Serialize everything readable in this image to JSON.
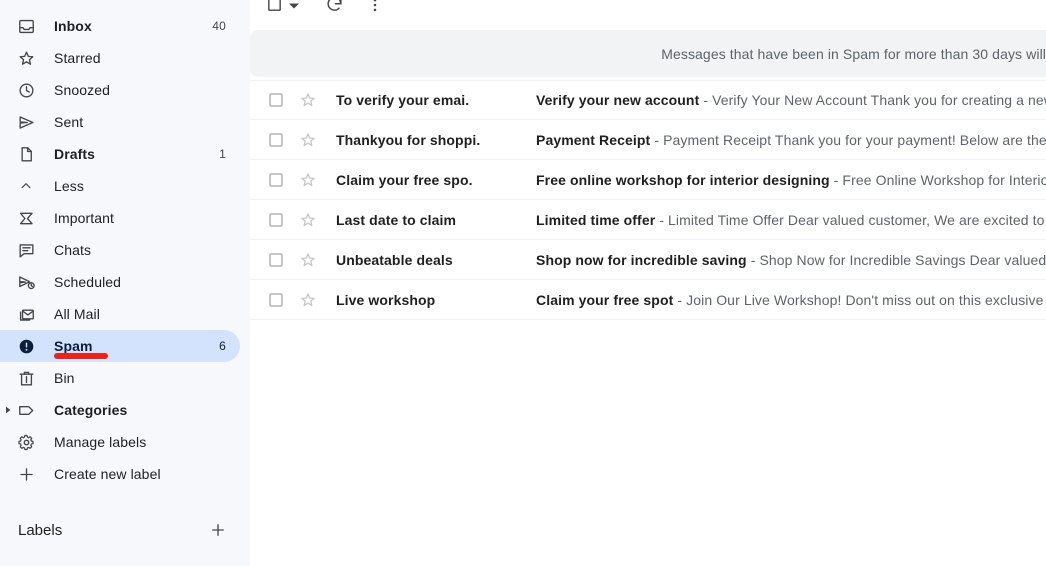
{
  "sidebar": {
    "items": [
      {
        "id": "inbox",
        "label": "Inbox",
        "count": "40",
        "icon": "inbox-icon",
        "bold": true,
        "selected": false
      },
      {
        "id": "starred",
        "label": "Starred",
        "count": "",
        "icon": "star-icon",
        "bold": false,
        "selected": false
      },
      {
        "id": "snoozed",
        "label": "Snoozed",
        "count": "",
        "icon": "clock-icon",
        "bold": false,
        "selected": false
      },
      {
        "id": "sent",
        "label": "Sent",
        "count": "",
        "icon": "send-icon",
        "bold": false,
        "selected": false
      },
      {
        "id": "drafts",
        "label": "Drafts",
        "count": "1",
        "icon": "document-icon",
        "bold": true,
        "selected": false
      },
      {
        "id": "less",
        "label": "Less",
        "count": "",
        "icon": "chevron-up-icon",
        "bold": false,
        "selected": false
      },
      {
        "id": "important",
        "label": "Important",
        "count": "",
        "icon": "important-icon",
        "bold": false,
        "selected": false
      },
      {
        "id": "chats",
        "label": "Chats",
        "count": "",
        "icon": "chat-icon",
        "bold": false,
        "selected": false
      },
      {
        "id": "scheduled",
        "label": "Scheduled",
        "count": "",
        "icon": "scheduled-send-icon",
        "bold": false,
        "selected": false
      },
      {
        "id": "all-mail",
        "label": "All Mail",
        "count": "",
        "icon": "all-mail-icon",
        "bold": false,
        "selected": false
      },
      {
        "id": "spam",
        "label": "Spam",
        "count": "6",
        "icon": "spam-alert-icon",
        "bold": true,
        "selected": true
      },
      {
        "id": "bin",
        "label": "Bin",
        "count": "",
        "icon": "trash-icon",
        "bold": false,
        "selected": false
      },
      {
        "id": "categories",
        "label": "Categories",
        "count": "",
        "icon": "label-tag-icon",
        "bold": true,
        "selected": false,
        "caret": true
      },
      {
        "id": "manage-labels",
        "label": "Manage labels",
        "count": "",
        "icon": "gear-icon",
        "bold": false,
        "selected": false
      },
      {
        "id": "create-new-label",
        "label": "Create new label",
        "count": "",
        "icon": "plus-icon",
        "bold": false,
        "selected": false
      }
    ],
    "labels_header": "Labels",
    "add_label_icon": "plus-icon",
    "selected_highlight_color": "#d3e3fd",
    "annotation_color": "#e8251d"
  },
  "toolbar": {
    "select_all_checkbox": "checkbox-icon",
    "select_dropdown": "chevron-down-icon",
    "refresh": "refresh-icon",
    "more": "more-vertical-icon"
  },
  "banner": {
    "text": "Messages that have been in Spam for more than 30 days will"
  },
  "mail_list": {
    "rows": [
      {
        "sender": "To verify your emai.",
        "subject": "Verify your new account",
        "separator": "-",
        "snippet": "Verify Your New Account Thank you for creating a new"
      },
      {
        "sender": "Thankyou for shoppi.",
        "subject": "Payment Receipt",
        "separator": "-",
        "snippet": "Payment Receipt Thank you for your payment! Below are the d"
      },
      {
        "sender": "Claim your free spo.",
        "subject": "Free online workshop for interior designing",
        "separator": "-",
        "snippet": "Free Online Workshop for Interior "
      },
      {
        "sender": "Last date to claim",
        "subject": "Limited time offer",
        "separator": "-",
        "snippet": "Limited Time Offer Dear valued customer, We are excited to a"
      },
      {
        "sender": "Unbeatable deals",
        "subject": "Shop now for incredible saving",
        "separator": "-",
        "snippet": "Shop Now for Incredible Savings Dear valued c"
      },
      {
        "sender": "Live workshop",
        "subject": "Claim your free spot",
        "separator": "-",
        "snippet": "Join Our Live Workshop! Don't miss out on this exclusive o"
      }
    ]
  }
}
